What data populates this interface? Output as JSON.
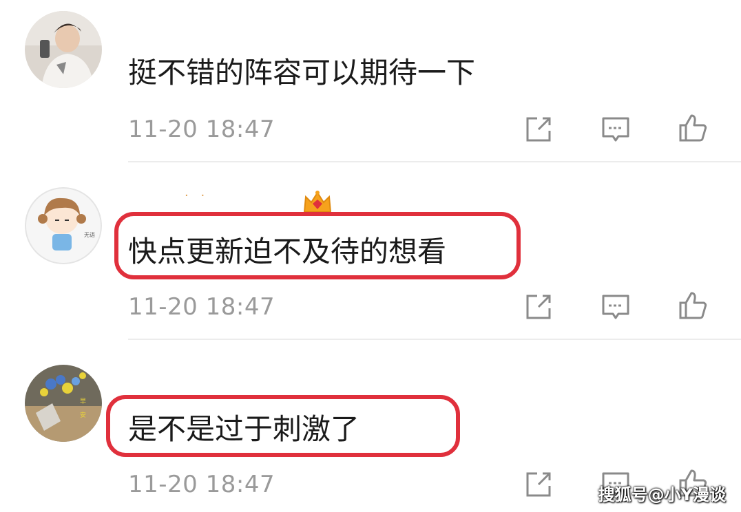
{
  "comments": [
    {
      "text": "挺不错的阵容可以期待一下",
      "time": "11-20 18:47"
    },
    {
      "text": "快点更新迫不及待的想看",
      "time": "11-20 18:47"
    },
    {
      "text": "是不是过于刺激了",
      "time": "11-20 18:47"
    }
  ],
  "icons": {
    "share": "share-icon",
    "reply": "comment-icon",
    "like": "thumbs-up-icon"
  },
  "colors": {
    "highlight": "#e0303c",
    "text": "#1a1a1a",
    "meta": "#9a9a9a"
  },
  "watermark": "搜狐号@小Y漫谈"
}
